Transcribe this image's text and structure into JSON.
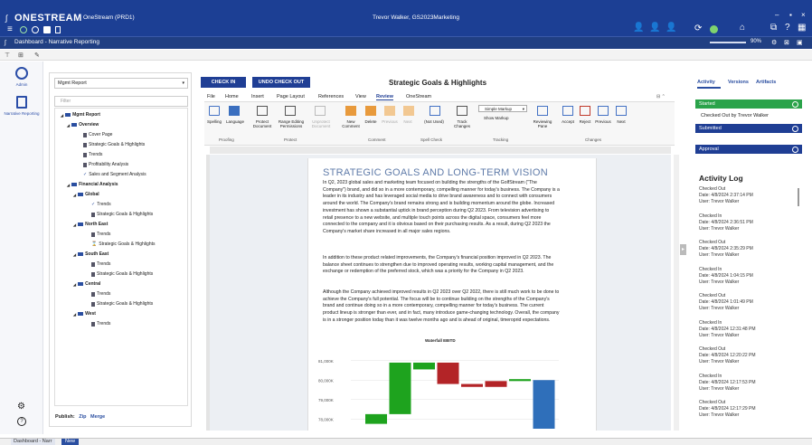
{
  "app": {
    "brand": "ONESTREAM",
    "instance": "OneStream (PRD1)",
    "user": "Trevor Walker, GS2023Marketing",
    "page_title": "Dashboard - Narrative Reporting",
    "zoom": "90%"
  },
  "left_nav": {
    "admin": "Admin",
    "narrative": "Narrative Reporting"
  },
  "tree": {
    "report_select": "Mgmt Report",
    "filter_placeholder": "Filter",
    "items": [
      "Mgmt Report",
      "Overview",
      "Cover Page",
      "Strategic Goals & Highlights",
      "Trends",
      "Profitability Analysis",
      "Sales and Segment Analysis",
      "Financial Analysis",
      "Global",
      "Trends",
      "Strategic Goals & Highlights",
      "North East",
      "Trends",
      "Strategic Goals & Highlights",
      "South East",
      "Trends",
      "Strategic Goals & Highlights",
      "Central",
      "Trends",
      "Strategic Goals & Highlights",
      "West",
      "Trends"
    ],
    "publish_label": "Publish:",
    "zip": "Zip",
    "merge": "Merge"
  },
  "editor": {
    "check_in": "CHECK IN",
    "undo_check_out": "UNDO CHECK OUT",
    "doc_title": "Strategic Goals & Highlights",
    "ribbon_tabs": [
      "File",
      "Home",
      "Insert",
      "Page Layout",
      "References",
      "View",
      "Review",
      "OneStream"
    ],
    "ribbon_buttons": {
      "spelling": "Spelling",
      "language": "Language",
      "protect_doc": "Protect Document",
      "range_editing": "Range Editing Permissions",
      "unprotect": "Unprotect Document",
      "new_comment": "New Comment",
      "delete": "Delete",
      "previous": "Previous",
      "next": "Next",
      "not_used": "(Not Used)",
      "track_changes": "Track Changes",
      "simple_markup": "Simple Markup",
      "show_markup": "Show Markup",
      "reviewing_pane": "Reviewing Pane",
      "accept": "Accept",
      "reject": "Reject",
      "prev2": "Previous",
      "next2": "Next"
    },
    "groups": [
      "Proofing",
      "Protect",
      "Comment",
      "Spell Check",
      "Tracking",
      "Changes"
    ],
    "heading": "STRATEGIC GOALS AND LONG-TERM VISION",
    "para1": "In Q2, 2023 global sales and marketing team focused on building the strengths of the GolfStream (\"The Company\") brand, and did so in a more contemporary, compelling manner for today's business. The Company is a leader in its industry and has leveraged social media to drive brand awareness and to connect with consumers around the world. The Company's brand remains strong and is building momentum around the globe. Increased investment has shown a substantial uptick in brand perception during Q2 2023. From television advertising to retail presence to a new website, and multiple touch points across the digital space, consumers feel more connected to the company and it is obvious based on their purchasing results. As a result, during Q2 2023 the Company's market share increased in all major sales regions.",
    "para2": "In addition to these product related improvements, the Company's financial position improved in Q2 2023. The balance sheet continues to strengthen due to improved operating results, working capital management, and the exchange or redemption of the preferred stock, which was a priority for the Company in Q2 2023.",
    "para3": "Although the Company achieved improved results in Q2 2023 over Q2 2022, there is still much work to be done to achieve the Company's full potential. The focus will be to continue building on the strengths of the Company's brand and continue doing so in a more contemporary, compelling manner for today's business. The current product lineup is stronger than ever, and in fact, many introduce game-changing technology. Overall, the company is in a stronger position today than it was twelve months ago and is ahead of original, timeroprid expectations.",
    "chart_title": "Waterfall EBITD",
    "chart_ticks": [
      "81,000K",
      "80,000K",
      "79,000K",
      "78,000K"
    ]
  },
  "chart_data": {
    "type": "bar",
    "title": "Waterfall EBITD",
    "ylim": [
      77500,
      81500
    ],
    "y_ticks": [
      "81,000K",
      "80,000K",
      "79,000K",
      "78,000K"
    ],
    "bars": [
      {
        "low": 77750,
        "high": 78250,
        "color": "#1ea31e"
      },
      {
        "low": 78250,
        "high": 80900,
        "color": "#1ea31e"
      },
      {
        "low": 80550,
        "high": 80900,
        "color": "#1ea31e"
      },
      {
        "low": 79800,
        "high": 80900,
        "color": "#b32427"
      },
      {
        "low": 79650,
        "high": 79800,
        "color": "#b32427"
      },
      {
        "low": 79650,
        "high": 79950,
        "color": "#b32427"
      },
      {
        "low": 79950,
        "high": 80050,
        "color": "#1ea31e"
      },
      {
        "low": 77500,
        "high": 80000,
        "color": "#2f6fba"
      }
    ]
  },
  "right": {
    "tabs": [
      "Activity",
      "Versions",
      "Artifacts"
    ],
    "states": [
      {
        "label": "Started",
        "color": "#2aa34a"
      },
      {
        "label": "Submitted",
        "color": "#1f3e94"
      },
      {
        "label": "Approval",
        "color": "#1f3e94"
      }
    ],
    "checked_out_note": "Checked Out by Trevor Walker",
    "log_title": "Activity Log",
    "log": [
      {
        "action": "Checked Out",
        "date": "Date: 4/8/2024 2:37:14 PM",
        "user": "User: Trevor Walker"
      },
      {
        "action": "Checked In",
        "date": "Date: 4/8/2024 2:36:51 PM",
        "user": "User: Trevor Walker"
      },
      {
        "action": "Checked Out",
        "date": "Date: 4/8/2024 2:35:29 PM",
        "user": "User: Trevor Walker"
      },
      {
        "action": "Checked In",
        "date": "Date: 4/8/2024 1:04:15 PM",
        "user": "User: Trevor Walker"
      },
      {
        "action": "Checked Out",
        "date": "Date: 4/8/2024 1:01:49 PM",
        "user": "User: Trevor Walker"
      },
      {
        "action": "Checked In",
        "date": "Date: 4/8/2024 12:31:48 PM",
        "user": "User: Trevor Walker"
      },
      {
        "action": "Checked Out",
        "date": "Date: 4/8/2024 12:20:22 PM",
        "user": "User: Trevor Walker"
      },
      {
        "action": "Checked In",
        "date": "Date: 4/8/2024 12:17:53 PM",
        "user": "User: Trevor Walker"
      },
      {
        "action": "Checked Out",
        "date": "Date: 4/8/2024 12:17:29 PM",
        "user": "User: Trevor Walker"
      }
    ]
  },
  "status": {
    "tab": "Dashboard - Narr",
    "new": "New"
  }
}
